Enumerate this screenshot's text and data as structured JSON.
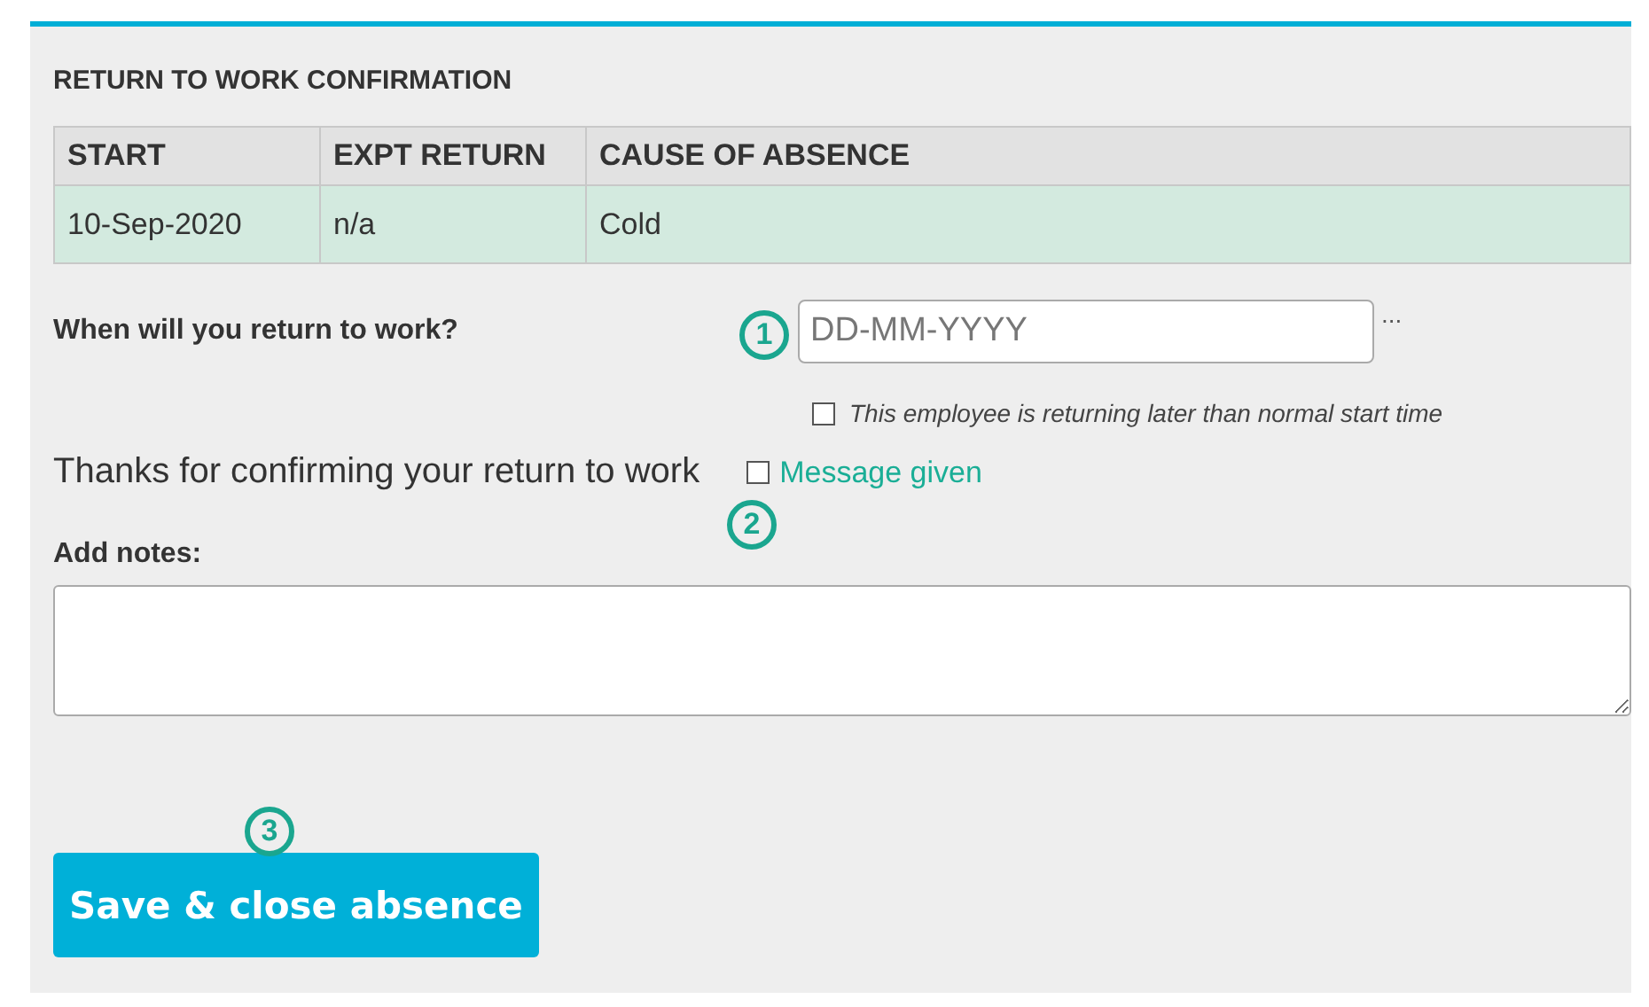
{
  "title": "RETURN TO WORK CONFIRMATION",
  "table": {
    "columns": [
      "START",
      "EXPT RETURN",
      "CAUSE OF ABSENCE"
    ],
    "rows": [
      [
        "10-Sep-2020",
        "n/a",
        "Cold"
      ]
    ]
  },
  "return_date": {
    "label": "When will you return to work?",
    "placeholder": "DD-MM-YYYY",
    "more": "...",
    "callout": "1"
  },
  "late_option": {
    "label": "This employee is returning later than normal start time",
    "checked": false
  },
  "thanks": {
    "text": "Thanks for confirming your return to work",
    "checkbox_label": "Message given",
    "checked": false,
    "callout": "2"
  },
  "notes": {
    "label": "Add notes:"
  },
  "save_button": {
    "label": "Save & close absence",
    "callout": "3"
  }
}
